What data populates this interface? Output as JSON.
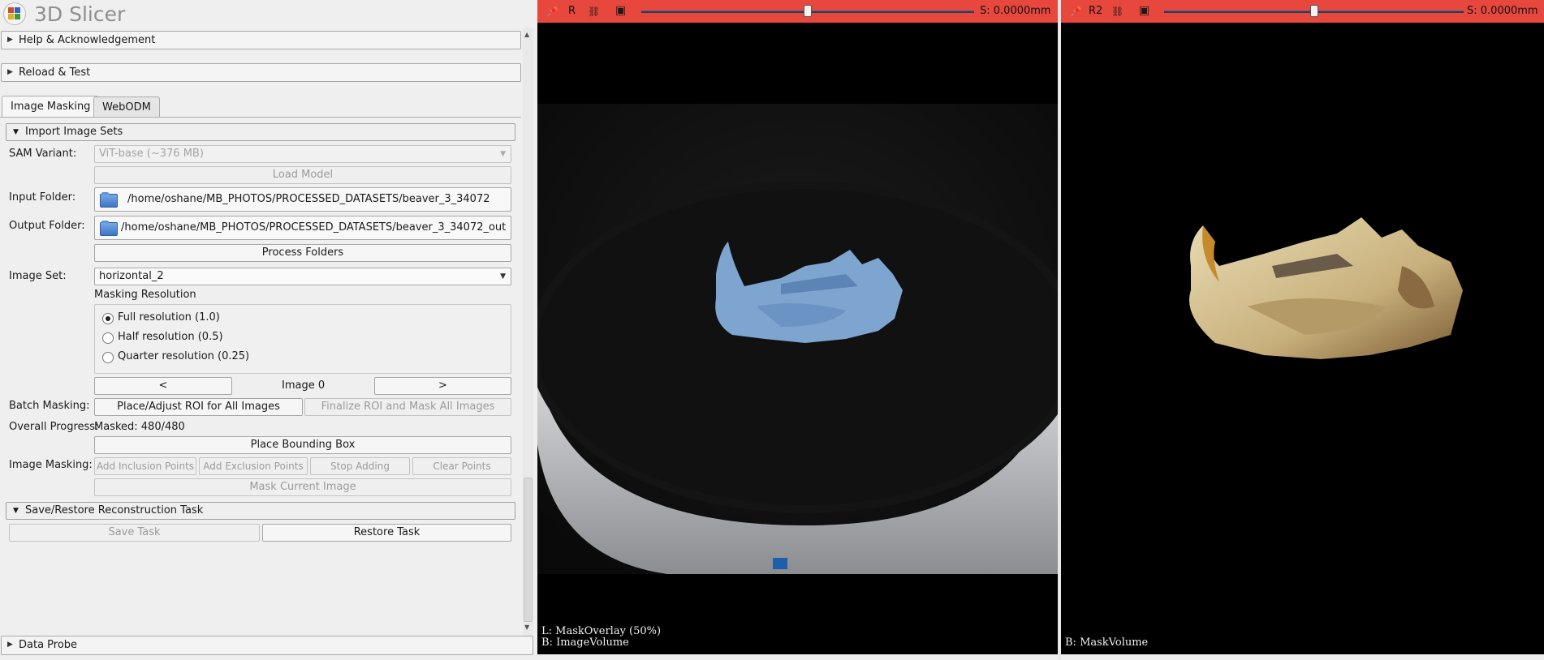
{
  "app": {
    "title": "3D Slicer"
  },
  "sections": {
    "help": "Help & Acknowledgement",
    "reload": "Reload & Test",
    "data_probe": "Data Probe"
  },
  "tabs": [
    {
      "label": "Image Masking",
      "active": true
    },
    {
      "label": "WebODM",
      "active": false
    }
  ],
  "import": {
    "header": "Import Image Sets",
    "sam_variant_label": "SAM Variant:",
    "sam_variant_value": "ViT-base (~376 MB)",
    "load_model": "Load Model",
    "input_folder_label": "Input Folder:",
    "input_folder": "/home/oshane/MB_PHOTOS/PROCESSED_DATASETS/beaver_3_34072",
    "output_folder_label": "Output Folder:",
    "output_folder": "/home/oshane/MB_PHOTOS/PROCESSED_DATASETS/beaver_3_34072_out",
    "process_folders": "Process Folders",
    "image_set_label": "Image Set:",
    "image_set_value": "horizontal_2",
    "masking_resolution_label": "Masking Resolution",
    "resolutions": [
      {
        "label": "Full resolution (1.0)",
        "selected": true
      },
      {
        "label": "Half resolution (0.5)",
        "selected": false
      },
      {
        "label": "Quarter resolution (0.25)",
        "selected": false
      }
    ],
    "prev": "<",
    "image_index": "Image 0",
    "next": ">",
    "batch_label": "Batch Masking:",
    "place_roi": "Place/Adjust ROI for All Images",
    "finalize_roi": "Finalize ROI and Mask All Images",
    "progress_label": "Overall Progress:",
    "progress_value": "Masked: 480/480",
    "place_bbox": "Place Bounding Box",
    "image_masking_label": "Image Masking:",
    "add_inclusion": "Add Inclusion Points",
    "add_exclusion": "Add Exclusion Points",
    "stop_adding": "Stop Adding",
    "clear_points": "Clear Points",
    "mask_current": "Mask Current Image"
  },
  "task": {
    "header": "Save/Restore Reconstruction Task",
    "save": "Save Task",
    "restore": "Restore Task"
  },
  "views": [
    {
      "name": "R",
      "slice_offset": "S: 0.0000mm",
      "slider_fraction": 0.5,
      "bar_color": "#e8473d",
      "corner_lines": [
        "L: MaskOverlay (50%)",
        "B: ImageVolume"
      ]
    },
    {
      "name": "R2",
      "slice_offset": "S: 0.0000mm",
      "slider_fraction": 0.5,
      "bar_color": "#e8473d",
      "corner_lines": [
        "B: MaskVolume"
      ]
    }
  ],
  "icons": [
    "pin-icon",
    "link-icon",
    "window-icon",
    "folder-icon",
    "expand-arrow-icon",
    "collapse-arrow-icon",
    "dropdown-arrow-icon"
  ]
}
